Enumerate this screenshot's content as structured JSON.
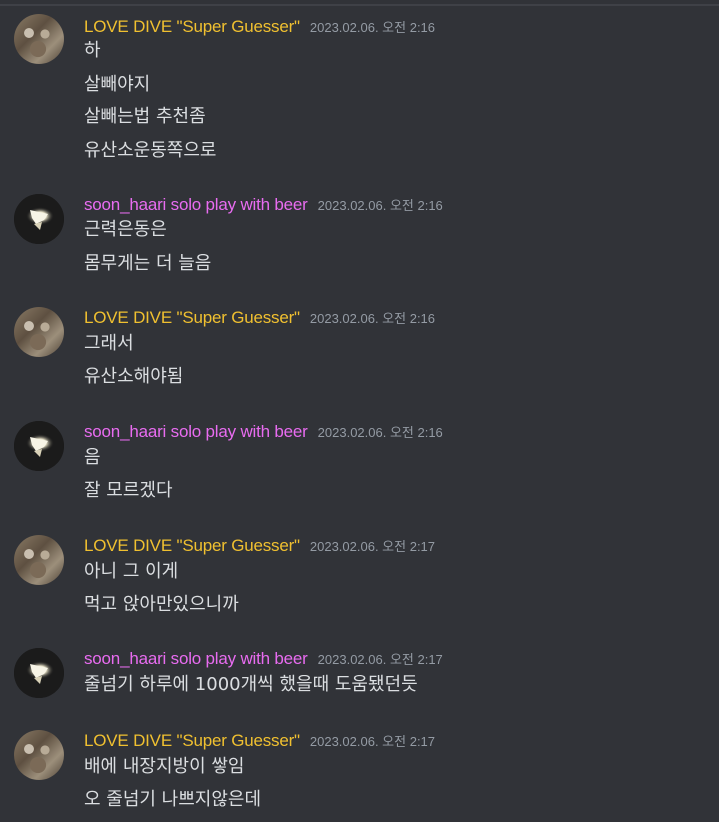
{
  "users": {
    "love": {
      "name": "LOVE DIVE \"Super Guesser\""
    },
    "soon": {
      "name": "soon_haari solo play with beer"
    }
  },
  "messages": [
    {
      "timestamp": "2023.02.06. 오전 2:16",
      "lines": [
        "하",
        "살빼야지",
        "살빼는법 추천좀",
        "유산소운동쪽으로"
      ]
    },
    {
      "timestamp": "2023.02.06. 오전 2:16",
      "lines": [
        "근력은동은",
        "몸무게는 더 늘음"
      ]
    },
    {
      "timestamp": "2023.02.06. 오전 2:16",
      "lines": [
        "그래서",
        "유산소해야됨"
      ]
    },
    {
      "timestamp": "2023.02.06. 오전 2:16",
      "lines": [
        "음",
        "잘 모르겠다"
      ]
    },
    {
      "timestamp": "2023.02.06. 오전 2:17",
      "lines": [
        "아니 그 이게",
        "먹고 앉아만있으니까"
      ]
    },
    {
      "timestamp": "2023.02.06. 오전 2:17",
      "lines": [
        "줄넘기 하루에 1000개씩 했을때 도움됐던듯"
      ]
    },
    {
      "timestamp": "2023.02.06. 오전 2:17",
      "lines": [
        "배에 내장지방이 쌓임",
        "오 줄넘기 나쁘지않은데"
      ]
    }
  ]
}
